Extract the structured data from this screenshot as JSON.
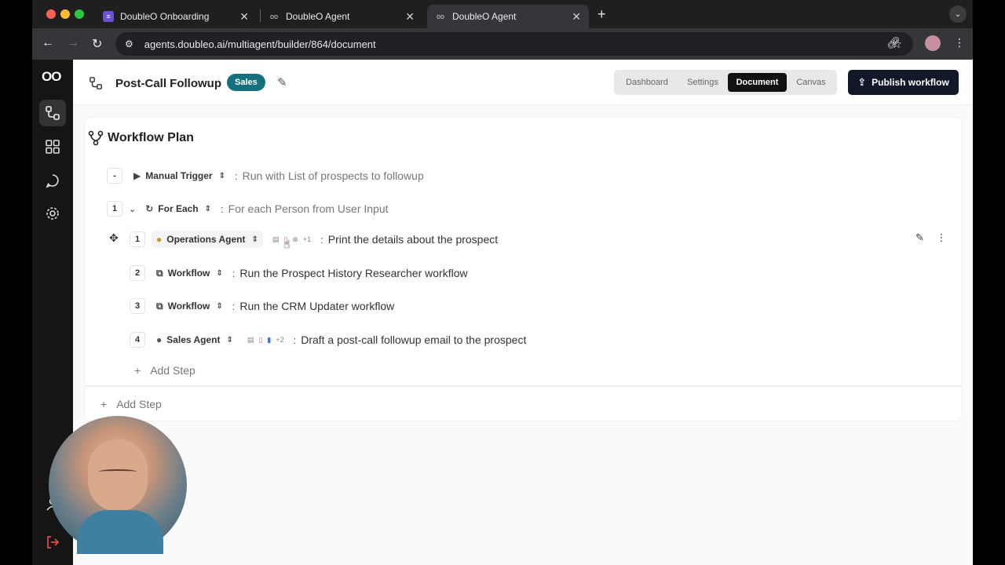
{
  "browser": {
    "tabs": [
      {
        "title": "DoubleO Onboarding"
      },
      {
        "title": "DoubleO Agent"
      },
      {
        "title": "DoubleO Agent"
      }
    ],
    "url": "agents.doubleo.ai/multiagent/builder/864/document"
  },
  "sidebar": {
    "logo": "OO"
  },
  "header": {
    "title": "Post-Call Followup",
    "badge": "Sales",
    "nav": [
      "Dashboard",
      "Settings",
      "Document",
      "Canvas"
    ],
    "active_nav": "Document",
    "publish_label": "Publish workflow"
  },
  "plan": {
    "title": "Workflow Plan",
    "trigger": {
      "marker": "-",
      "type": "Manual Trigger",
      "description": "Run with List of prospects to followup"
    },
    "loop": {
      "index": "1",
      "type": "For Each",
      "description": "For each Person from User Input"
    },
    "steps": [
      {
        "index": "1",
        "type": "Operations Agent",
        "description": "Print the details about the prospect",
        "extra": "+1"
      },
      {
        "index": "2",
        "type": "Workflow",
        "description": "Run the Prospect History Researcher workflow"
      },
      {
        "index": "3",
        "type": "Workflow",
        "description": "Run the CRM Updater workflow"
      },
      {
        "index": "4",
        "type": "Sales Agent",
        "description": "Draft a post-call followup email to the prospect",
        "extra": "+2"
      }
    ],
    "inner_add_step": "Add Step",
    "outer_add_step": "Add Step"
  },
  "colors": {
    "badge": "#14707d",
    "publish": "#111827",
    "sidebar": "#151515"
  }
}
